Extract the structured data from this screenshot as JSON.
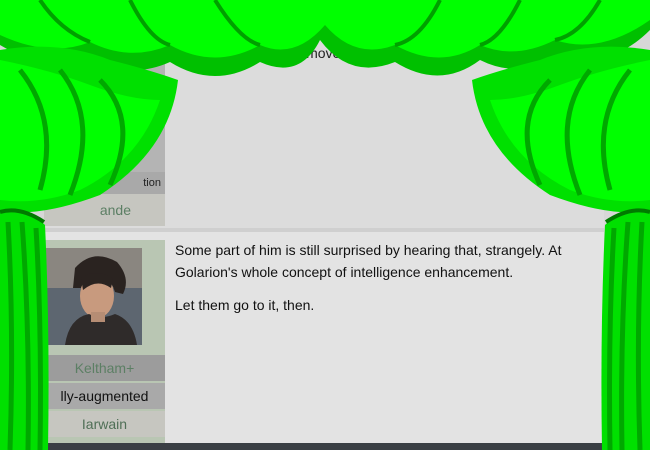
{
  "prev_post": {
    "text_fragment": "etting move,",
    "screen_fragment": "tion",
    "author_fragment": "ande"
  },
  "post": {
    "paragraphs": [
      "Some part of him is still surprised by hearing that, strangely.  At",
      "Golarion's whole concept of intelligence enhancement.",
      "Let them go to it, then."
    ],
    "character": "Keltham+",
    "screen_name": "lly-augmented",
    "author": "Iarwain"
  },
  "colors": {
    "curtain_bright": "#00ff00",
    "curtain_dark": "#00b300"
  }
}
